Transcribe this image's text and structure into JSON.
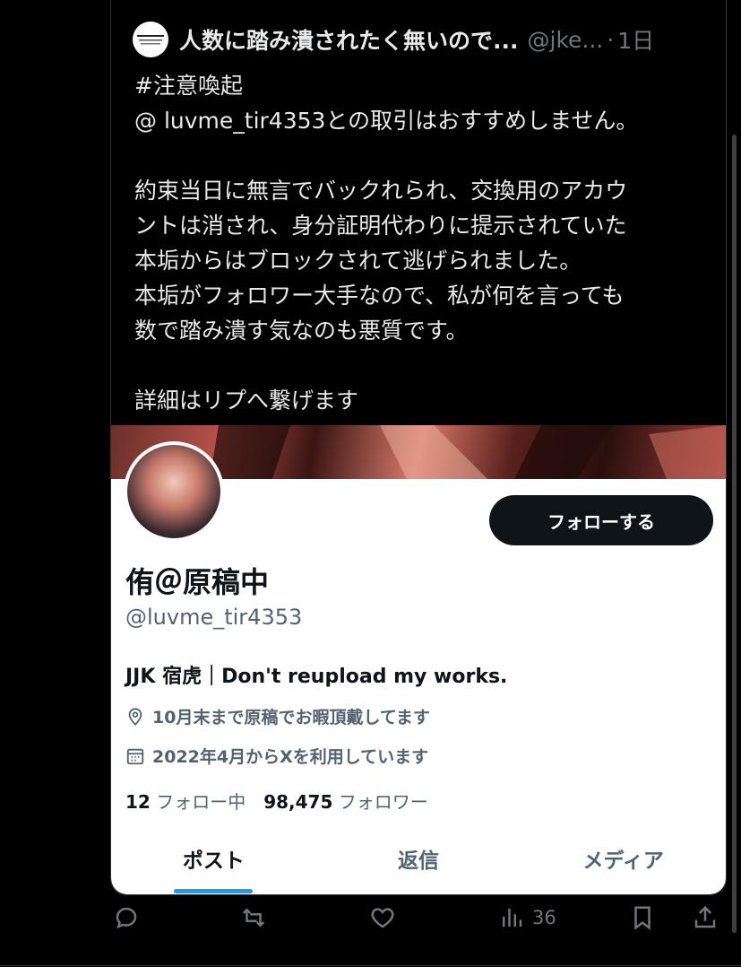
{
  "quote": {
    "author_name": "人数に踏み潰されたく無いので...",
    "author_handle": "@jke...",
    "separator": "·",
    "time": "1日",
    "lines": [
      "#注意喚起",
      "@ luvme_tir4353との取引はおすすめしません。",
      "",
      "約束当日に無言でバックれられ、交換用のアカウ",
      "ントは消され、身分証明代わりに提示されていた",
      "本垢からはブロックされて逃げられました。",
      "本垢がフォロワー大手なので、私が何を言っても",
      "数で踏み潰す気なのも悪質です。",
      "",
      "詳細はリプへ繋げます"
    ]
  },
  "profile": {
    "follow_label": "フォローする",
    "name": "侑＠原稿中",
    "handle": "@luvme_tir4353",
    "bio": "JJK 宿虎｜Don't reupload my works.",
    "location": "10月末まで原稿でお暇頂戴してます",
    "joined": "2022年4月からXを利用しています",
    "following_count": "12",
    "following_label": "フォロー中",
    "followers_count": "98,475",
    "followers_label": "フォロワー",
    "tabs": [
      "ポスト",
      "返信",
      "メディア"
    ],
    "active_tab": "ポスト"
  },
  "actions": {
    "reply_icon": "reply-icon",
    "retweet_icon": "retweet-icon",
    "like_icon": "heart-icon",
    "views_icon": "views-icon",
    "views_count": "36",
    "bookmark_icon": "bookmark-icon",
    "share_icon": "share-icon"
  },
  "colors": {
    "background": "#000000",
    "text_primary": "#e7e9ea",
    "text_secondary": "#71767b",
    "accent": "#1d9bf0",
    "button_dark": "#0f1419"
  }
}
